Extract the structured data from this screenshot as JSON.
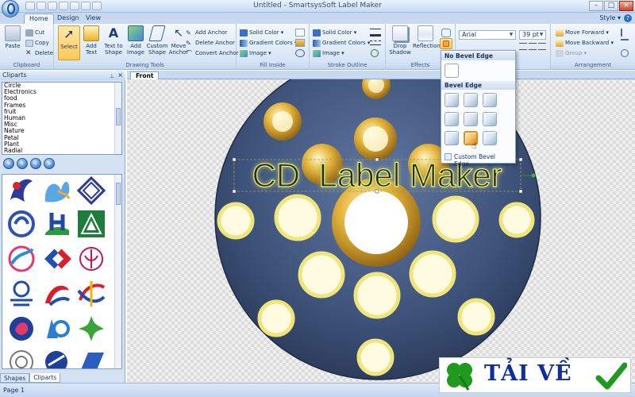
{
  "window": {
    "title": "Untitled - SmartsysSoft Label Maker"
  },
  "tabs": [
    "Home",
    "Design",
    "View"
  ],
  "style_menu": "Style",
  "ribbon": {
    "clipboard": {
      "label": "Clipboard",
      "paste": "Paste",
      "cut": "Cut",
      "copy": "Copy",
      "delete": "Delete"
    },
    "drawing_tools": {
      "label": "Drawing Tools",
      "select": "Select",
      "add_text": "Add Text",
      "text_to_shape": "Text to Shape",
      "add_image": "Add Image",
      "custom_shape": "Custom Shape",
      "move_anchor": "Move Anchor",
      "add_anchor": "Add Anchor",
      "delete_anchor": "Delete Anchor",
      "convert_anchor": "Convert Anchor"
    },
    "fill_inside": {
      "label": "Fill Inside",
      "solid_color": "Solid Color",
      "gradient_colors": "Gradient Colors",
      "image": "Image"
    },
    "stroke_outline": {
      "label": "Stroke Outline",
      "solid_color": "Solid Color",
      "gradient_colors": "Gradient Colors",
      "image": "Image"
    },
    "effects": {
      "label": "Effects",
      "drop_shadow": "Drop Shadow",
      "reflection": "Reflection"
    },
    "font": {
      "name": "Arial",
      "size": "39 pt"
    },
    "arrangement": {
      "label": "Arrangement",
      "move_forward": "Move Forward",
      "move_backward": "Move Backward",
      "group": "Group"
    }
  },
  "bevel_dropdown": {
    "no_bevel_header": "No Bevel Edge",
    "bevel_header": "Bevel Edge",
    "custom_label": "Custom Bevel Edge..."
  },
  "cliparts": {
    "title": "Cliparts",
    "categories": [
      "Circle",
      "Electronics",
      "food",
      "Frames",
      "fruit",
      "Human",
      "Misc",
      "Nature",
      "Petal",
      "Plant",
      "Radial"
    ],
    "tabs": [
      "Shapes",
      "Cliparts"
    ]
  },
  "document": {
    "tab": "Front",
    "label_text": "CD  Label Maker"
  },
  "status": {
    "page": "Page 1"
  },
  "banner": {
    "text": "TẢI VỀ"
  },
  "colors": {
    "disc": "#3f5478",
    "accent": "#e38b1a",
    "banner_text": "#0d2f9a",
    "check": "#1f9a1f"
  }
}
